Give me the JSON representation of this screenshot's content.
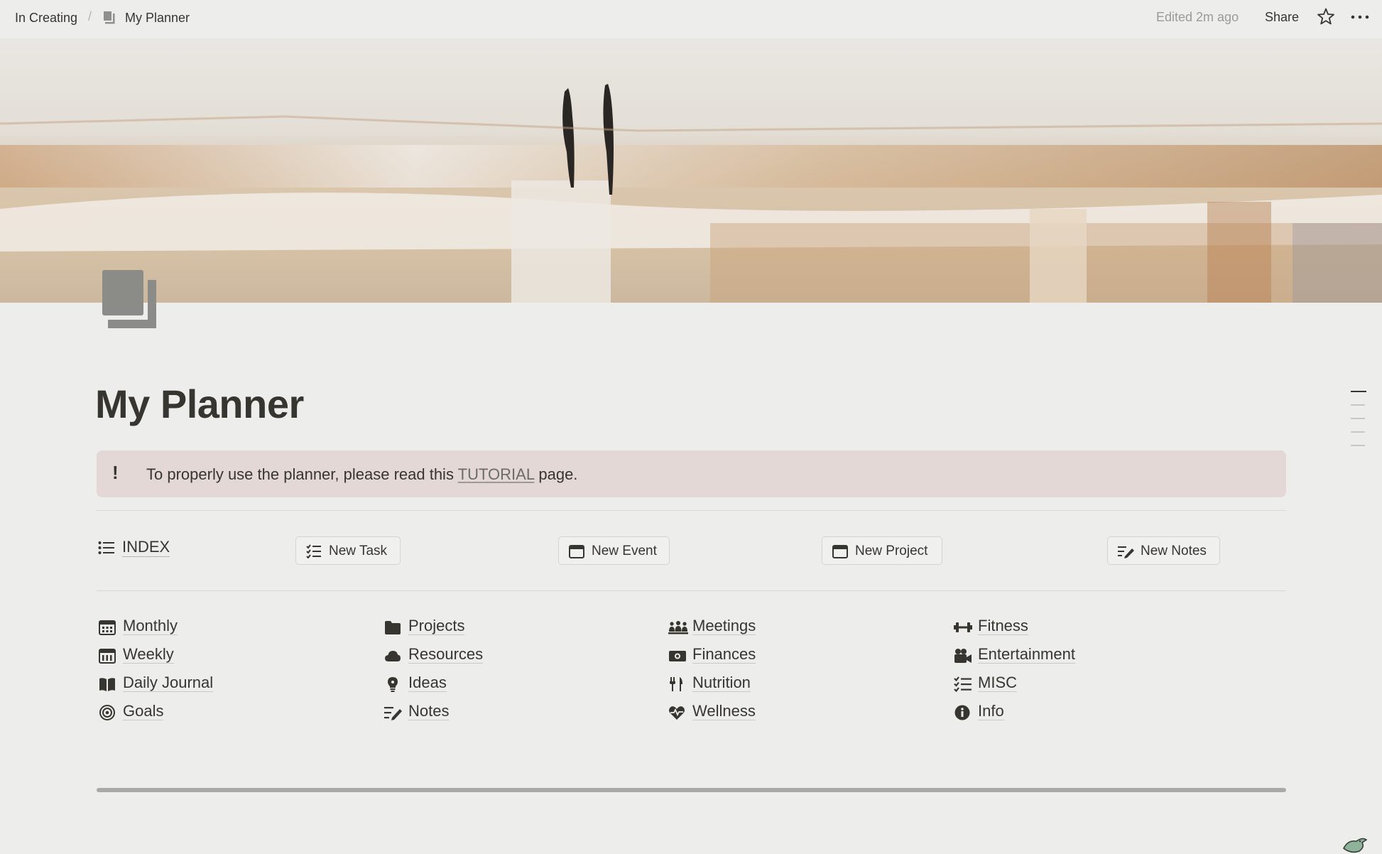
{
  "topbar": {
    "breadcrumb_parent": "In Creating",
    "breadcrumb_separator": "/",
    "breadcrumb_page": "My Planner",
    "page_icon": "page-icon",
    "edited": "Edited 2m ago",
    "share_label": "Share",
    "favorite_icon": "star-icon",
    "more_icon": "more-icon"
  },
  "page": {
    "title": "My Planner",
    "icon": "documents-icon"
  },
  "callout": {
    "icon": "!",
    "text_before": "To properly use the planner, please read this ",
    "link": "TUTORIAL",
    "text_after": " page."
  },
  "actions": {
    "index_label": "INDEX",
    "buttons": [
      {
        "label": "New Task",
        "icon": "checklist-icon"
      },
      {
        "label": "New Event",
        "icon": "calendar-icon"
      },
      {
        "label": "New Project",
        "icon": "calendar-icon"
      },
      {
        "label": "New Notes",
        "icon": "write-icon"
      }
    ]
  },
  "nav": {
    "col1": [
      {
        "label": "Monthly",
        "icon": "calendar-icon"
      },
      {
        "label": "Weekly",
        "icon": "calendar-icon"
      },
      {
        "label": "Daily Journal",
        "icon": "book-icon"
      },
      {
        "label": "Goals",
        "icon": "target-icon"
      }
    ],
    "col2": [
      {
        "label": "Projects",
        "icon": "folder-icon"
      },
      {
        "label": "Resources",
        "icon": "cloud-icon"
      },
      {
        "label": "Ideas",
        "icon": "lightbulb-icon"
      },
      {
        "label": "Notes",
        "icon": "write-icon"
      }
    ],
    "col3": [
      {
        "label": "Meetings",
        "icon": "people-icon"
      },
      {
        "label": "Finances",
        "icon": "money-icon"
      },
      {
        "label": "Nutrition",
        "icon": "fork-knife-icon"
      },
      {
        "label": "Wellness",
        "icon": "heart-pulse-icon"
      }
    ],
    "col4": [
      {
        "label": "Fitness",
        "icon": "dumbbell-icon"
      },
      {
        "label": "Entertainment",
        "icon": "video-camera-icon"
      },
      {
        "label": "MISC",
        "icon": "checklist-icon"
      },
      {
        "label": "Info",
        "icon": "info-icon"
      }
    ]
  },
  "colors": {
    "background": "#ededec",
    "text": "#37352f",
    "callout_bg": "#e3d8d6",
    "muted": "#9b9a97"
  }
}
